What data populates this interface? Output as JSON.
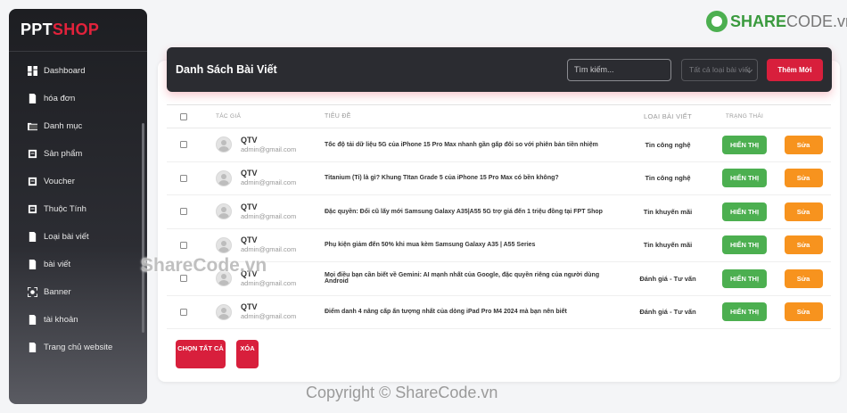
{
  "brand": {
    "part1": "PPT",
    "part2": "SHOP",
    "color_accent": "#e2223b"
  },
  "sidebar": {
    "items": [
      {
        "label": "Dashboard",
        "icon": "dashboard-grid-icon"
      },
      {
        "label": "hóa đơn",
        "icon": "document-icon"
      },
      {
        "label": "Danh mục",
        "icon": "folder-icon"
      },
      {
        "label": "Sản phẩm",
        "icon": "box-icon"
      },
      {
        "label": "Voucher",
        "icon": "ticket-icon"
      },
      {
        "label": "Thuộc Tính",
        "icon": "tag-icon"
      },
      {
        "label": "Loại bài viết",
        "icon": "category-icon"
      },
      {
        "label": "bài viết",
        "icon": "article-icon"
      },
      {
        "label": "Banner",
        "icon": "image-icon"
      },
      {
        "label": "tài khoản",
        "icon": "user-icon"
      },
      {
        "label": "Trang chủ website",
        "icon": "home-icon"
      }
    ]
  },
  "header": {
    "title": "Danh Sách Bài Viết",
    "search_placeholder": "Tìm kiếm...",
    "category_select": "Tất cả loại bài viết",
    "add_label": "Thêm Mới"
  },
  "table": {
    "columns": {
      "author": "TÁC GIẢ",
      "title": "TIÊU ĐỀ",
      "category": "LOẠI BÀI VIẾT",
      "status": "TRẠNG THÁI"
    },
    "rows": [
      {
        "author": "QTV",
        "email": "admin@gmail.com",
        "title": "Tốc độ tải dữ liệu 5G của iPhone 15 Pro Max nhanh gần gấp đôi so với phiên bản tiền nhiệm",
        "category": "Tin công nghệ",
        "status": "HIỂN THỊ",
        "edit": "Sửa"
      },
      {
        "author": "QTV",
        "email": "admin@gmail.com",
        "title": "Titanium (Ti) là gì? Khung TItan Grade 5 của iPhone 15 Pro Max có bền không?",
        "category": "Tin công nghệ",
        "status": "HIỂN THỊ",
        "edit": "Sửa"
      },
      {
        "author": "QTV",
        "email": "admin@gmail.com",
        "title": "Đặc quyền: Đổi cũ lấy mới Samsung Galaxy A35|A55 5G trợ giá đến 1 triệu đồng tại FPT Shop",
        "category": "Tin khuyến mãi",
        "status": "HIỂN THỊ",
        "edit": "Sửa"
      },
      {
        "author": "QTV",
        "email": "admin@gmail.com",
        "title": "Phụ kiện giảm đến 50% khi mua kèm Samsung Galaxy A35 | A55 Series",
        "category": "Tin khuyến mãi",
        "status": "HIỂN THỊ",
        "edit": "Sửa"
      },
      {
        "author": "QTV",
        "email": "admin@gmail.com",
        "title": "Mọi điều bạn cần biết về Gemini: AI mạnh nhất của Google, đặc quyền riêng của người dùng Android",
        "category": "Đánh giá - Tư vấn",
        "status": "HIỂN THỊ",
        "edit": "Sửa"
      },
      {
        "author": "QTV",
        "email": "admin@gmail.com",
        "title": "Điểm danh 4 nâng cấp ấn tượng nhất của dòng iPad Pro M4 2024 mà bạn nên biết",
        "category": "Đánh giá - Tư vấn",
        "status": "HIỂN THỊ",
        "edit": "Sửa"
      }
    ]
  },
  "footer": {
    "select_all": "CHỌN TẤT CẢ",
    "delete": "XÓA"
  },
  "watermarks": {
    "logo_part1": "SHARE",
    "logo_part2": "CODE",
    "logo_part3": ".vn",
    "middle": "ShareCode.vn",
    "bottom": "Copyright © ShareCode.vn"
  },
  "colors": {
    "show": "#4caf50",
    "edit": "#f7931e",
    "primary_red": "#d81f3c",
    "header_bg": "#2b2c31"
  }
}
